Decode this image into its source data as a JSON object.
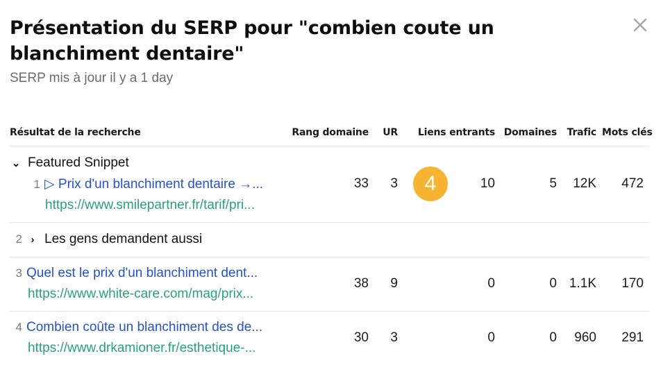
{
  "modal": {
    "title": "Présentation du SERP pour \"combien coute un blanchiment dentaire\"",
    "subtitle": "SERP mis à jour il y a 1 day",
    "close_icon": "close-icon"
  },
  "table": {
    "headers": [
      "Résultat de la recherche",
      "Rang domaine",
      "UR",
      "Liens entrants",
      "Domaines",
      "Trafic",
      "Mots clés"
    ],
    "featured_snippet": {
      "group_label": "Featured Snippet",
      "expanded": true,
      "item": {
        "rank": "1",
        "title": "▷ Prix d'un blanchiment dentaire →...",
        "url": "https://www.smilepartner.fr/tarif/pri...",
        "rang_domaine": "33",
        "ur": "3",
        "badge": "4",
        "liens_entrants": "10",
        "domaines": "5",
        "trafic": "12K",
        "mots_cles": "472"
      }
    },
    "people_also_ask": {
      "rank": "2",
      "label": "Les gens demandent aussi",
      "expanded": false
    },
    "results": [
      {
        "rank": "3",
        "title": "Quel est le prix d'un blanchiment dent...",
        "url": "https://www.white-care.com/mag/prix...",
        "rang_domaine": "38",
        "ur": "9",
        "liens_entrants": "0",
        "domaines": "0",
        "trafic": "1.1K",
        "mots_cles": "170"
      },
      {
        "rank": "4",
        "title": "Combien coûte un blanchiment des de...",
        "url": "https://www.drkamioner.fr/esthetique-...",
        "rang_domaine": "30",
        "ur": "3",
        "liens_entrants": "0",
        "domaines": "0",
        "trafic": "960",
        "mots_cles": "291"
      }
    ]
  },
  "colors": {
    "link": "#2553c5",
    "url": "#2aa07a",
    "badge": "#f5b431",
    "muted": "#6b6b6b"
  }
}
